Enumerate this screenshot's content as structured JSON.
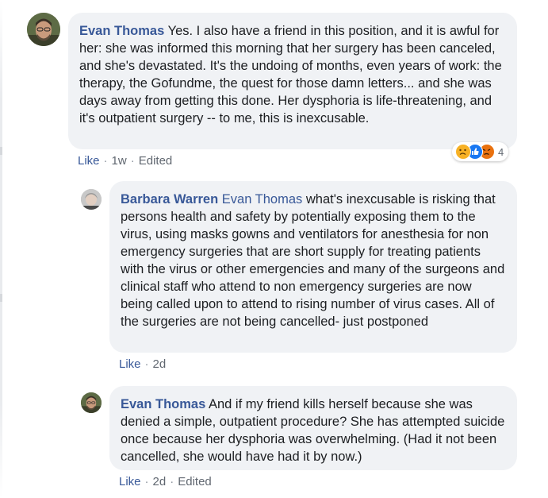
{
  "comments": [
    {
      "author": "Evan Thomas",
      "text": "Yes. I also have a friend in this position, and it is awful for her: she was informed this morning that her surgery has been canceled, and she's devastated. It's the undoing of months, even years of work: the therapy, the Gofundme, the quest for those damn letters... and she was days away from getting this done. Her dysphoria is life-threatening, and it's outpatient surgery -- to me, this is inexcusable.",
      "like_label": "Like",
      "time": "1w",
      "edited": "Edited",
      "reactions": {
        "icons": [
          "sad-icon",
          "like-icon",
          "angry-icon"
        ],
        "count": "4"
      }
    },
    {
      "author": "Barbara Warren",
      "mention": "Evan Thomas",
      "text": "what's inexcusable is risking that persons health and safety by potentially exposing them to the virus, using masks gowns and ventilators for anesthesia for non emergency surgeries that are short supply for treating patients with the virus or other emergencies and many of the surgeons and clinical staff who attend to non emergency surgeries are now being called upon to attend to rising number of virus cases. All of the surgeries are not being cancelled- just postponed",
      "like_label": "Like",
      "time": "2d"
    },
    {
      "author": "Evan Thomas",
      "text": "And if my friend kills herself because she was denied a simple, outpatient procedure? She has attempted suicide once because her dysphoria was overwhelming. (Had it not been cancelled, she would have had it by now.)",
      "like_label": "Like",
      "time": "2d",
      "edited": "Edited"
    }
  ],
  "colors": {
    "link": "#385898",
    "bubble": "#f0f2f5",
    "meta": "#606770",
    "sad": "#f7b125",
    "like": "#1877f2",
    "angry": "#e9710f"
  }
}
